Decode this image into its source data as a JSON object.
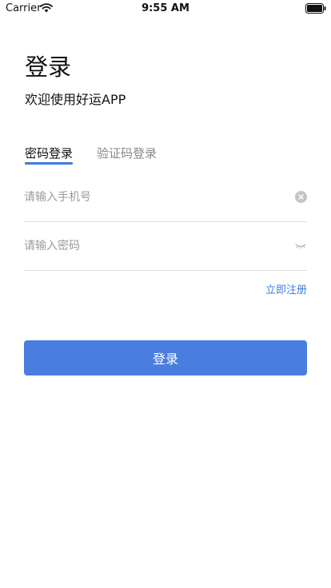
{
  "status_bar": {
    "carrier": "Carrier",
    "time": "9:55 AM",
    "wifi_icon": "wifi-icon",
    "battery_icon": "battery-icon"
  },
  "header": {
    "title": "登录",
    "subtitle": "欢迎使用好运APP"
  },
  "tabs": [
    {
      "label": "密码登录",
      "active": true
    },
    {
      "label": "验证码登录",
      "active": false
    }
  ],
  "form": {
    "phone": {
      "value": "",
      "placeholder": "请输入手机号",
      "clear_icon": "clear-icon"
    },
    "password": {
      "value": "",
      "placeholder": "请输入密码",
      "toggle_icon": "eye-closed-icon"
    },
    "register_label": "立即注册",
    "submit_label": "登录"
  },
  "colors": {
    "accent": "#4a7de0",
    "link": "#3f7ce0",
    "placeholder": "#9a9a9a",
    "inactive_tab": "#888888",
    "divider": "#dddddd"
  }
}
